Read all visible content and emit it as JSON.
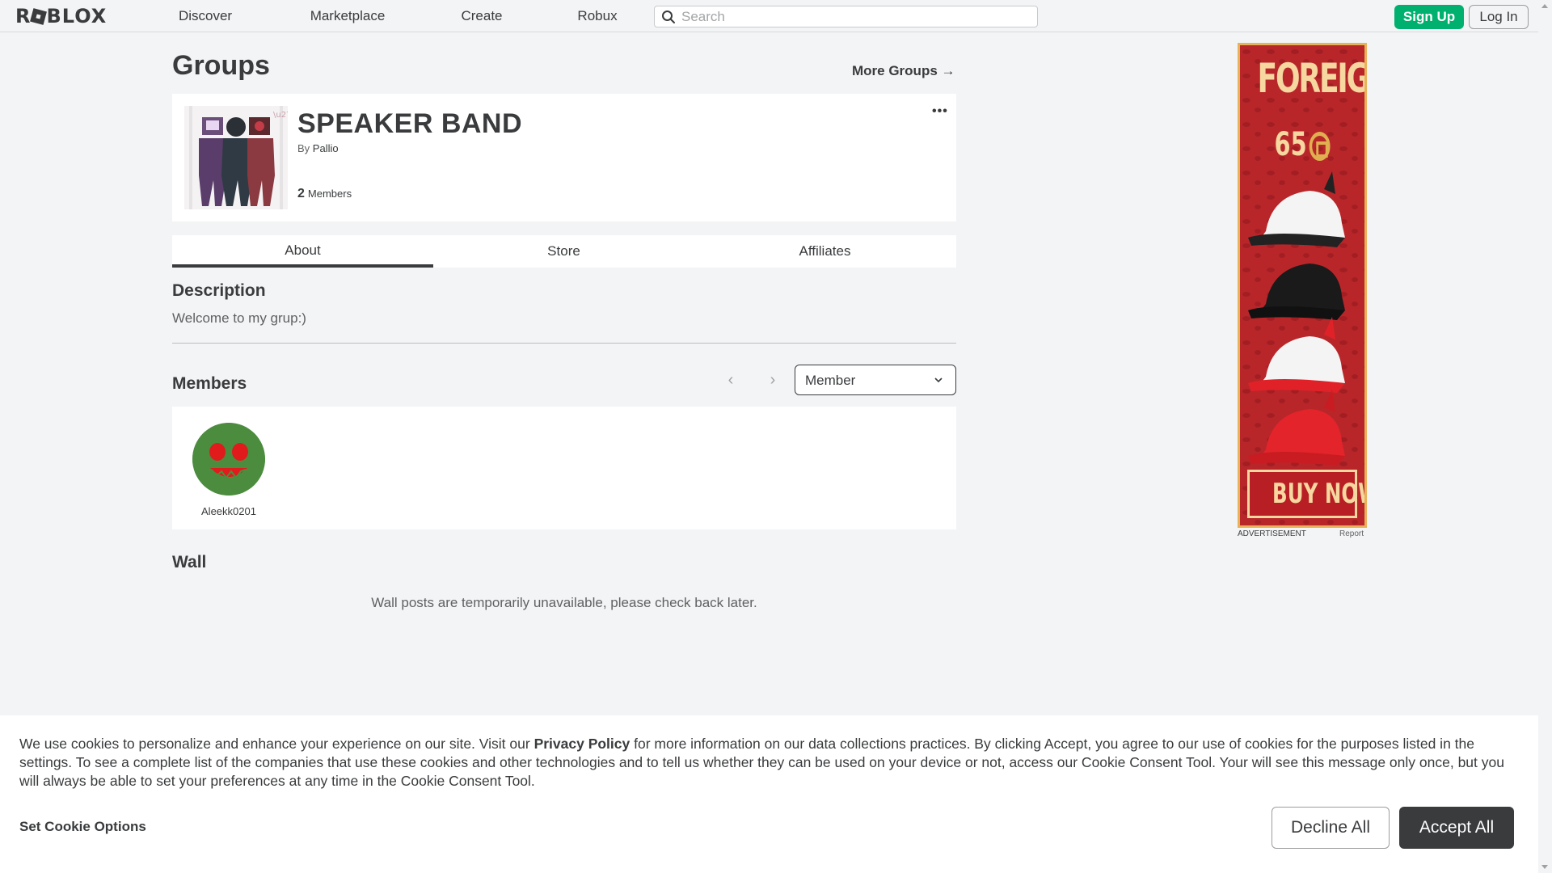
{
  "nav": {
    "logo": "ROBLOX",
    "links": [
      "Discover",
      "Marketplace",
      "Create",
      "Robux"
    ],
    "search_placeholder": "Search",
    "signup_label": "Sign Up",
    "login_label": "Log In"
  },
  "page": {
    "title": "Groups",
    "more_groups": "More Groups →"
  },
  "group": {
    "name": "SPEAKER BAND",
    "by_prefix": "By",
    "owner": "Pallio",
    "member_count": "2",
    "members_label": "Members",
    "more_menu": "•••"
  },
  "tabs": [
    "About",
    "Store",
    "Affiliates"
  ],
  "active_tab": "About",
  "about": {
    "description_heading": "Description",
    "description_text": "Welcome to my grup:)",
    "members_heading": "Members",
    "role_filter": "Member",
    "members": [
      {
        "name": "Aleekk0201"
      }
    ],
    "wall_heading": "Wall",
    "wall_message": "Wall posts are temporarily unavailable, please check back later."
  },
  "ad": {
    "title": "FOREIGN",
    "price": "65",
    "cta": "BUY NOW!",
    "label": "ADVERTISEMENT",
    "report": "Report",
    "background_color": "#b8262a",
    "accent_color": "#f6d7a0"
  },
  "cookie": {
    "text_before_link": "We use cookies to personalize and enhance your experience on our site. Visit our",
    "link": "Privacy Policy",
    "text_after_link": "for more information on our data collections practices. By clicking Accept, you agree to our use of cookies for the purposes listed in the settings. To see a complete list of the companies that use these cookies and other technologies and to tell us whether they can be used on your device or not, access our Cookie Consent Tool. Your will see this message only once, but you will always be able to set your preferences at any time in the Cookie Consent Tool.",
    "options_label": "Set Cookie Options",
    "decline_label": "Decline All",
    "accept_label": "Accept All"
  },
  "colors": {
    "signup_green": "#00b06f",
    "text_dark": "#393b3d",
    "page_bg": "#f2f4f5"
  }
}
